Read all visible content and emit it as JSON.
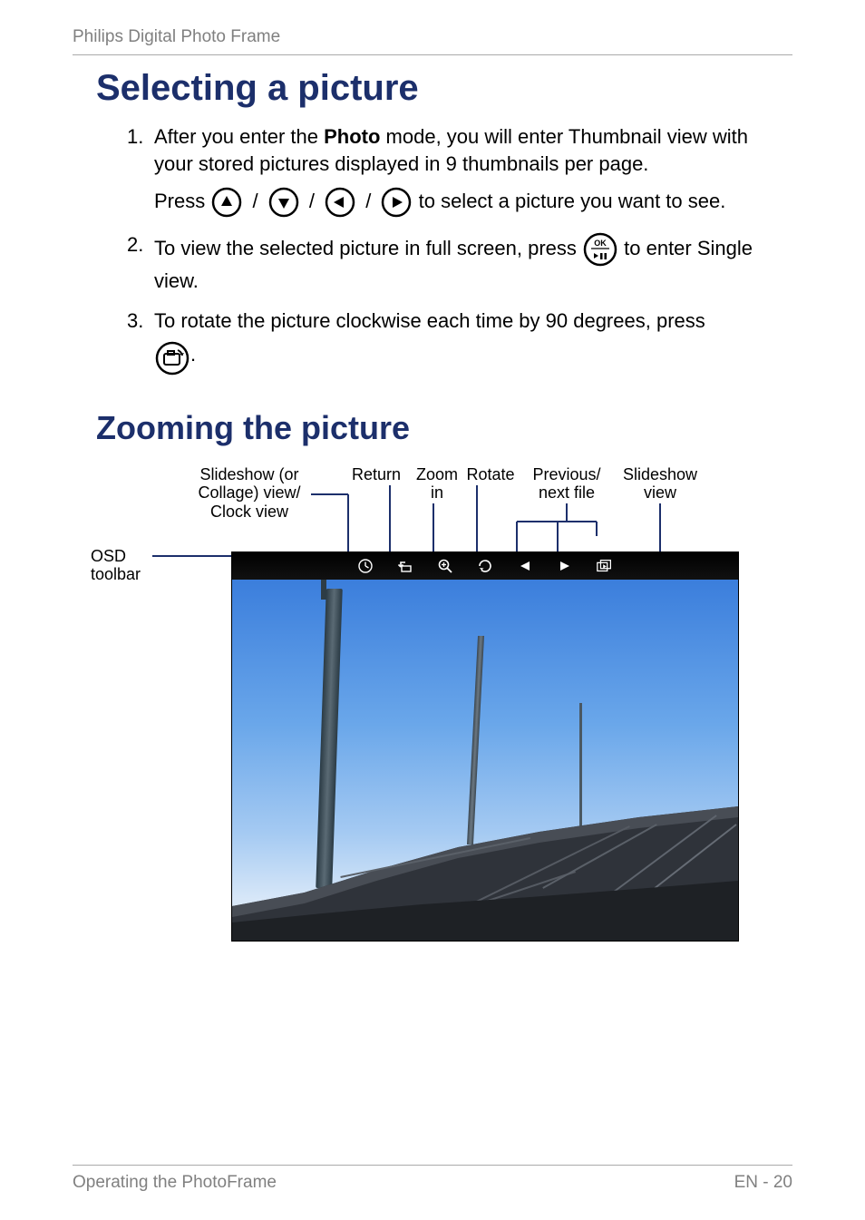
{
  "header": {
    "title": "Philips Digital Photo Frame"
  },
  "section1": {
    "heading": "Selecting a picture",
    "items": [
      {
        "num": "1.",
        "text_before_bold": "After you enter the ",
        "bold": "Photo",
        "text_after_bold": " mode, you will enter Thumbnail view with your stored pictures displayed in 9 thumbnails per page.",
        "press_label": "Press ",
        "select_label": " to select a picture you want to see."
      },
      {
        "num": "2.",
        "text_a": "To view the selected picture in full screen, press ",
        "text_b": " to enter Single view."
      },
      {
        "num": "3.",
        "text_a": "To rotate the picture clockwise each time by 90 degrees, press ",
        "text_b": "."
      }
    ]
  },
  "section2": {
    "heading": "Zooming the picture"
  },
  "diagram": {
    "labels": {
      "osd_toolbar": "OSD toolbar",
      "slideshow_collage": "Slideshow (or Collage) view/ Clock view",
      "return": "Return",
      "zoom_in": "Zoom in",
      "rotate": "Rotate",
      "prev_next": "Previous/ next file",
      "slideshow_view": "Slideshow view"
    }
  },
  "footer": {
    "left": "Operating the PhotoFrame",
    "right": "EN - 20"
  },
  "icons": {
    "up": "up-arrow",
    "down": "down-arrow",
    "left": "left-arrow",
    "right": "right-arrow",
    "ok": "ok-play-pause",
    "rotate": "rotate-camera"
  }
}
